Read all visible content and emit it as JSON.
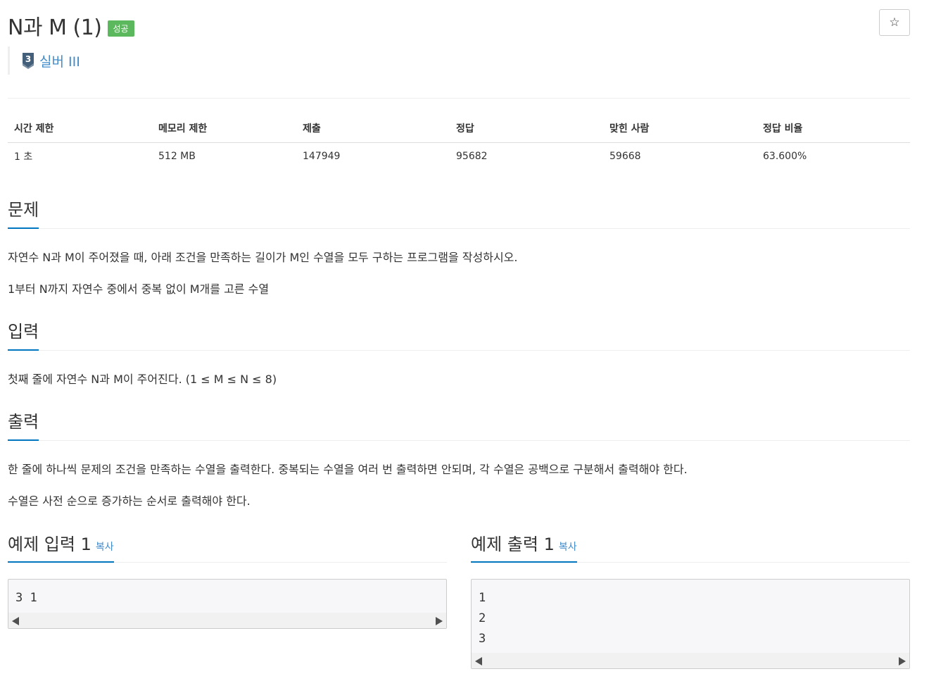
{
  "problem": {
    "title": "N과 M (1)",
    "status_badge": "성공",
    "star_icon": "☆",
    "tier": {
      "number": "3",
      "label": "실버 III",
      "color": "#435f7a"
    }
  },
  "info_table": {
    "headers": [
      "시간 제한",
      "메모리 제한",
      "제출",
      "정답",
      "맞힌 사람",
      "정답 비율"
    ],
    "values": [
      "1 초",
      "512 MB",
      "147949",
      "95682",
      "59668",
      "63.600%"
    ]
  },
  "sections": {
    "problem": {
      "heading": "문제",
      "paragraphs": [
        "자연수 N과 M이 주어졌을 때, 아래 조건을 만족하는 길이가 M인 수열을 모두 구하는 프로그램을 작성하시오.",
        "1부터 N까지 자연수 중에서 중복 없이 M개를 고른 수열"
      ]
    },
    "input": {
      "heading": "입력",
      "paragraphs": [
        "첫째 줄에 자연수 N과 M이 주어진다. (1 ≤ M ≤ N ≤ 8)"
      ]
    },
    "output": {
      "heading": "출력",
      "paragraphs": [
        "한 줄에 하나씩 문제의 조건을 만족하는 수열을 출력한다. 중복되는 수열을 여러 번 출력하면 안되며, 각 수열은 공백으로 구분해서 출력해야 한다.",
        "수열은 사전 순으로 증가하는 순서로 출력해야 한다."
      ]
    }
  },
  "examples": {
    "input": {
      "heading": "예제 입력 1",
      "copy_label": "복사",
      "code": "3 1"
    },
    "output": {
      "heading": "예제 출력 1",
      "copy_label": "복사",
      "code": "1\n2\n3"
    }
  },
  "colors": {
    "accent": "#0076c0",
    "success": "#5cb85c",
    "link": "#428bca"
  }
}
